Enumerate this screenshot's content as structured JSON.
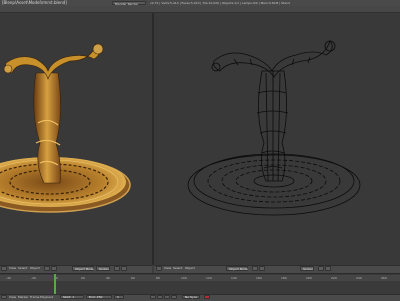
{
  "window": {
    "title": "[Blenp\\Asset\\Model\\rmrst.blend]"
  },
  "header": {
    "render_button": "Blender Render",
    "info": "v2.72 | Verts:5,414 | Faces:5,010 | Tris:10,020 | Objects:1/1 | Lamps:0/0 | Mem:6.61M | Stand"
  },
  "viewport_left": {
    "view_menu": "View",
    "select_menu": "Select",
    "object_menu": "Object",
    "mode": "Object Mode",
    "pivot": "Global"
  },
  "viewport_right": {
    "view_menu": "View",
    "select_menu": "Select",
    "object_menu": "Object",
    "mode": "Object Mode",
    "pivot": "Global"
  },
  "timeline": {
    "ticks": [
      "-40",
      "-20",
      "0",
      "20",
      "40",
      "60",
      "80",
      "100",
      "120",
      "140",
      "160",
      "180",
      "200",
      "220",
      "240",
      "260"
    ],
    "footer": {
      "view": "View",
      "marker": "Marker",
      "frame": "Frame",
      "playback": "Playback",
      "start": "Start: 1",
      "end": "End: 250",
      "current": "1",
      "sync": "No Sync"
    }
  },
  "colors": {
    "accent_green": "#5aa84a",
    "model_gold": "#c8902a",
    "wire": "#0c0c0c"
  }
}
